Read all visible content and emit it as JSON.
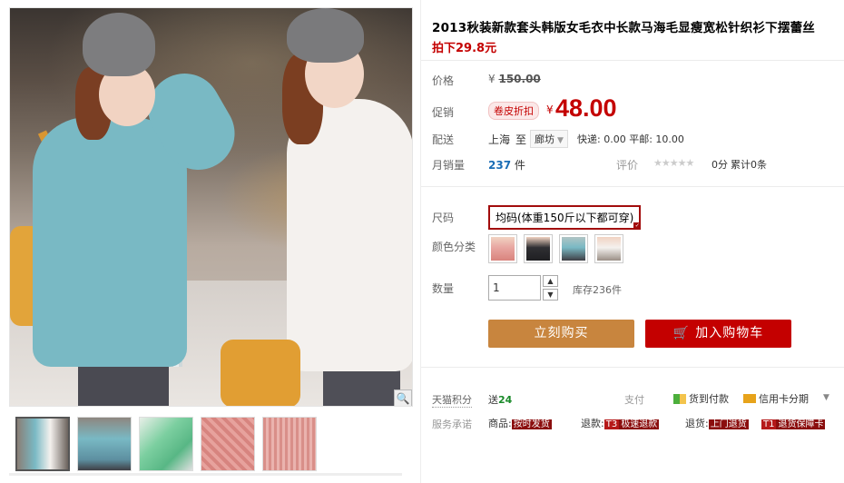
{
  "product": {
    "title": "2013秋装新款套头韩版女毛衣中长款马海毛显瘦宽松针织衫下摆蕾丝",
    "subtitle": "拍下29.8元"
  },
  "price": {
    "label": "价格",
    "currency": "¥",
    "original": "150.00"
  },
  "promo": {
    "label": "促销",
    "tag": "卷皮折扣",
    "currency": "¥",
    "price": "48.00"
  },
  "shipping": {
    "label": "配送",
    "from": "上海",
    "to": "至",
    "city": "廊坊",
    "fee": "快递: 0.00 平邮: 10.00"
  },
  "sales": {
    "label": "月销量",
    "count": "237",
    "unit": "件",
    "rating_label": "评价",
    "stars": "★★★★★",
    "score": "0分",
    "reviews": "累计0条"
  },
  "size": {
    "label": "尺码",
    "selected": "均码(体重150斤以下都可穿)"
  },
  "color": {
    "label": "颜色分类",
    "swatches": [
      "pink",
      "black",
      "blue",
      "white"
    ]
  },
  "quantity": {
    "label": "数量",
    "value": "1",
    "stock": "库存236件"
  },
  "actions": {
    "buy_now": "立刻购买",
    "add_cart": "加入购物车"
  },
  "points": {
    "label": "天猫积分",
    "prefix": "送",
    "value": "24"
  },
  "payment": {
    "label": "支付",
    "cod": "货到付款",
    "card": "信用卡分期"
  },
  "service": {
    "label": "服务承诺",
    "items": [
      {
        "text": "商品:",
        "tag": "按时发货"
      },
      {
        "text": "退款:",
        "tag": "T3",
        "tag2": "极速退款"
      },
      {
        "text": "退货:",
        "tag": "上门退货"
      },
      {
        "text": "",
        "tag": "T1",
        "tag2": "退货保障卡"
      }
    ]
  },
  "icons": {
    "zoom": "magnifier-icon",
    "cart": "cart-icon"
  },
  "colors": {
    "accent_red": "#c40000",
    "buy_orange": "#c8853e",
    "link_blue": "#1a6db5"
  }
}
